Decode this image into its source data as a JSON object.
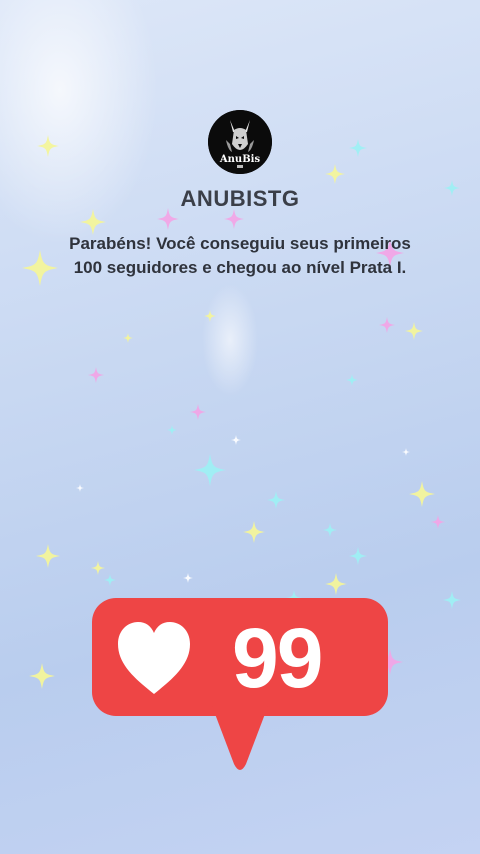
{
  "profile": {
    "avatar_logo_text": "AnuBis",
    "username": "ANUBISTG"
  },
  "message": "Parabéns! Você conseguiu seus primeiros 100 seguidores e chegou ao nível Prata I.",
  "notification": {
    "icon": "heart-icon",
    "count": "99",
    "bubble_color": "#ee4545"
  },
  "colors": {
    "background": "#c8d8f2",
    "text": "#2f333c"
  }
}
